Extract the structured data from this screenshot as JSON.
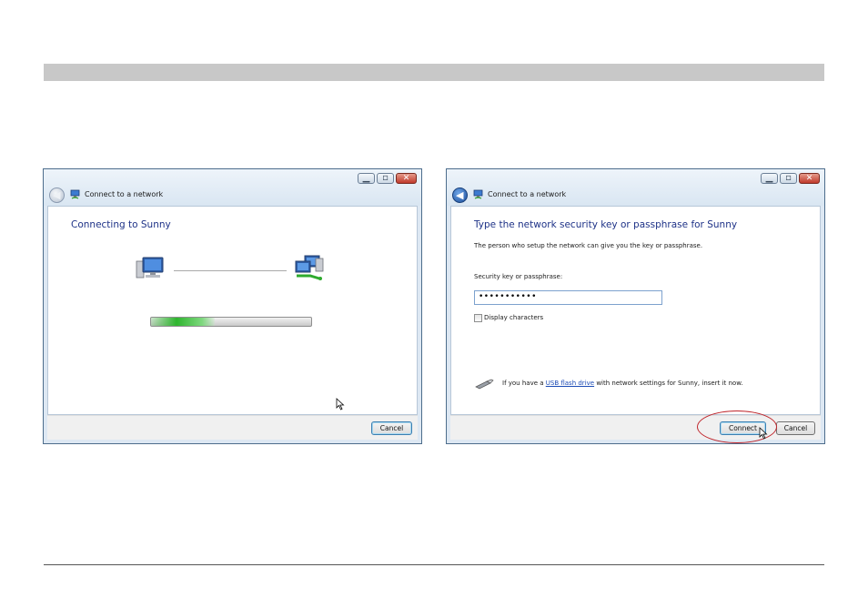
{
  "left_window": {
    "title": "Connect to a network",
    "heading": "Connecting to Sunny",
    "progress_fraction": 0.4,
    "cancel_label": "Cancel"
  },
  "right_window": {
    "title": "Connect to a network",
    "heading": "Type the network security key or passphrase for Sunny",
    "subtext": "The person who setup the network can give you the key or passphrase.",
    "field_label": "Security key or passphrase:",
    "field_value": "•••••••••••",
    "checkbox_label": "Display characters",
    "usb_prefix": "If you have a ",
    "usb_link": "USB flash drive",
    "usb_suffix": " with network settings for Sunny, insert it now.",
    "connect_label": "Connect",
    "cancel_label": "Cancel"
  },
  "colors": {
    "heading_blue": "#1e3287",
    "highlight_red": "#c0272d",
    "progress_green": "#2fb52f"
  }
}
